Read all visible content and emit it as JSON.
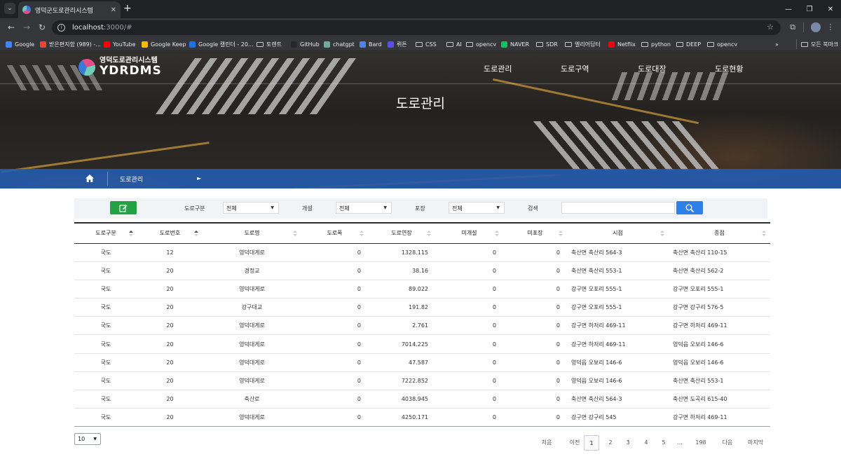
{
  "browser": {
    "tab_title": "영덕군도로관리시스템",
    "url_host": "localhost",
    "url_rest": ":3000/#",
    "bookmarks": [
      {
        "label": "Google",
        "color": "#4285f4",
        "kind": "icon"
      },
      {
        "label": "받은편지함 (989) -...",
        "color": "#ea4335",
        "kind": "icon"
      },
      {
        "label": "YouTube",
        "color": "#ff0000",
        "kind": "icon"
      },
      {
        "label": "Google Keep",
        "color": "#fbbc04",
        "kind": "icon"
      },
      {
        "label": "Google 캘린더 - 20...",
        "color": "#1a73e8",
        "kind": "icon"
      },
      {
        "label": "토렌트",
        "color": "",
        "kind": "folder"
      },
      {
        "label": "GitHub",
        "color": "#24292f",
        "kind": "icon"
      },
      {
        "label": "chatgpt",
        "color": "#74aa9c",
        "kind": "icon"
      },
      {
        "label": "Bard",
        "color": "#4e82ee",
        "kind": "icon"
      },
      {
        "label": "뤼튼",
        "color": "#5b4cf5",
        "kind": "icon"
      },
      {
        "label": "CSS",
        "color": "",
        "kind": "folder"
      },
      {
        "label": "AI",
        "color": "",
        "kind": "folder"
      },
      {
        "label": "opencv",
        "color": "",
        "kind": "folder"
      },
      {
        "label": "NAVER",
        "color": "#03c75a",
        "kind": "icon"
      },
      {
        "label": "SDR",
        "color": "",
        "kind": "folder"
      },
      {
        "label": "엘리어답터",
        "color": "",
        "kind": "folder"
      },
      {
        "label": "Netflix",
        "color": "#e50914",
        "kind": "icon"
      },
      {
        "label": "python",
        "color": "",
        "kind": "folder"
      },
      {
        "label": "DEEP",
        "color": "",
        "kind": "folder"
      },
      {
        "label": "opencv",
        "color": "",
        "kind": "folder"
      }
    ],
    "bookmarks_more": "»",
    "all_bookmarks": "모든 북마크"
  },
  "site": {
    "logo_sub": "영덕도로관리시스템",
    "logo_main": "YDRDMS",
    "nav": [
      "도로관리",
      "도로구역",
      "도로대장",
      "도로현황"
    ],
    "page_title": "도로관리",
    "breadcrumb": "도로관리"
  },
  "filters": {
    "road_type_label": "도로구분",
    "road_type_value": "전체",
    "open_label": "개설",
    "open_value": "전체",
    "paving_label": "포장",
    "paving_value": "전체",
    "search_label": "검색",
    "search_value": ""
  },
  "table": {
    "columns": [
      "도로구분",
      "도로번호",
      "도로명",
      "도로폭",
      "도로연장",
      "미개설",
      "미포장",
      "시점",
      "종점"
    ],
    "rows": [
      [
        "국도",
        "12",
        "영덕대게로",
        "0",
        "1328.115",
        "0",
        "0",
        "축산면 축산리 564-3",
        "축산면 축산리 110-15"
      ],
      [
        "국도",
        "20",
        "경정교",
        "0",
        "38.16",
        "0",
        "0",
        "축산면 축산리 553-1",
        "축산면 축산리 562-2"
      ],
      [
        "국도",
        "20",
        "영덕대게로",
        "0",
        "89.022",
        "0",
        "0",
        "강구면 오포리 555-1",
        "강구면 오포리 555-1"
      ],
      [
        "국도",
        "20",
        "강구대교",
        "0",
        "191.82",
        "0",
        "0",
        "강구면 오포리 555-1",
        "강구면 강구리 576-5"
      ],
      [
        "국도",
        "20",
        "영덕대게로",
        "0",
        "2.761",
        "0",
        "0",
        "강구면 하저리 469-11",
        "강구면 하저리 469-11"
      ],
      [
        "국도",
        "20",
        "영덕대게로",
        "0",
        "7014.225",
        "0",
        "0",
        "강구면 하저리 469-11",
        "영덕읍 오보리 146-6"
      ],
      [
        "국도",
        "20",
        "영덕대게로",
        "0",
        "47.587",
        "0",
        "0",
        "영덕읍 오보리 146-6",
        "영덕읍 오보리 146-6"
      ],
      [
        "국도",
        "20",
        "영덕대게로",
        "0",
        "7222.852",
        "0",
        "0",
        "영덕읍 오보리 146-6",
        "축산면 축산리 553-1"
      ],
      [
        "국도",
        "20",
        "축산로",
        "0",
        "4038.945",
        "0",
        "0",
        "축산면 축산리 564-3",
        "축산면 도곡리 615-40"
      ],
      [
        "국도",
        "20",
        "영덕대게로",
        "0",
        "4250.171",
        "0",
        "0",
        "강구면 강구리 545",
        "강구면 하저리 469-11"
      ]
    ]
  },
  "footer": {
    "page_size": "10",
    "pagination": [
      "처음",
      "이전",
      "1",
      "2",
      "3",
      "4",
      "5",
      "...",
      "198",
      "다음",
      "마지막"
    ],
    "current_page": "1"
  }
}
